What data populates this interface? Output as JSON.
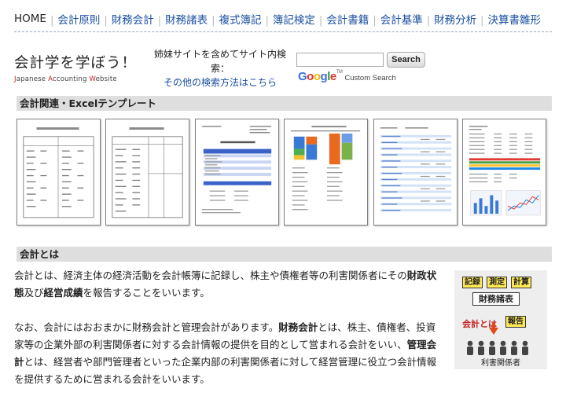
{
  "nav": {
    "home": "HOME",
    "items": [
      "会計原則",
      "財務会計",
      "財務諸表",
      "複式簿記",
      "簿記検定",
      "会計書籍",
      "会計基準",
      "財務分析",
      "決算書雛形"
    ]
  },
  "logo": {
    "title": "会計学を学ぼう！",
    "sub_parts": [
      "J",
      "apanese ",
      "A",
      "ccounting ",
      "W",
      "ebsite"
    ]
  },
  "search": {
    "note": "姉妹サイトを含めてサイト内検索：",
    "other_link": "その他の検索方法はこちら",
    "input_value": "",
    "button_label": "Search",
    "google_letters": [
      "G",
      "o",
      "o",
      "g",
      "l",
      "e"
    ],
    "tm": "TM",
    "custom_label": "Custom Search"
  },
  "colors": {
    "link": "#1a4fa0",
    "accent_red": "#c62020",
    "tag_yellow": "#ffea55",
    "section_bg": "#dedede",
    "google": [
      "#3a6fd8",
      "#d8352a",
      "#f0b400",
      "#3a6fd8",
      "#2a9a3a",
      "#d8352a"
    ]
  },
  "templates_section": {
    "title": "会計関連・Excelテンプレート",
    "thumbnail_count": 6
  },
  "about_section": {
    "title": "会計とは",
    "para1": {
      "t1": "会計とは、経済主体の経済活動を会計帳簿に記録し、株主や債権者等の利害関係者にその",
      "b1": "財政状態",
      "t2": "及び",
      "b2": "経営成績",
      "t3": "を報告することをいいます。"
    },
    "para2": {
      "t1": "なお、会計にはおおまかに財務会計と管理会計があります。",
      "b1": "財務会計",
      "t2": "とは、株主、債権者、投資家等の企業外部の利害関係者に対する会計情報の提供を目的として営まれる会計をいい、",
      "b2": "管理会計",
      "t3": "とは、経営者や部門管理者といった企業内部の利害関係者に対して経営管理に役立つ会計情報を提供するために営まれる会計をいいます。"
    }
  },
  "illustration": {
    "tags": [
      "記録",
      "測定",
      "計算"
    ],
    "zaimu": "財務諸表",
    "kaikei": "会計とは",
    "report": "報告",
    "stakeholders": "利害関係者"
  }
}
